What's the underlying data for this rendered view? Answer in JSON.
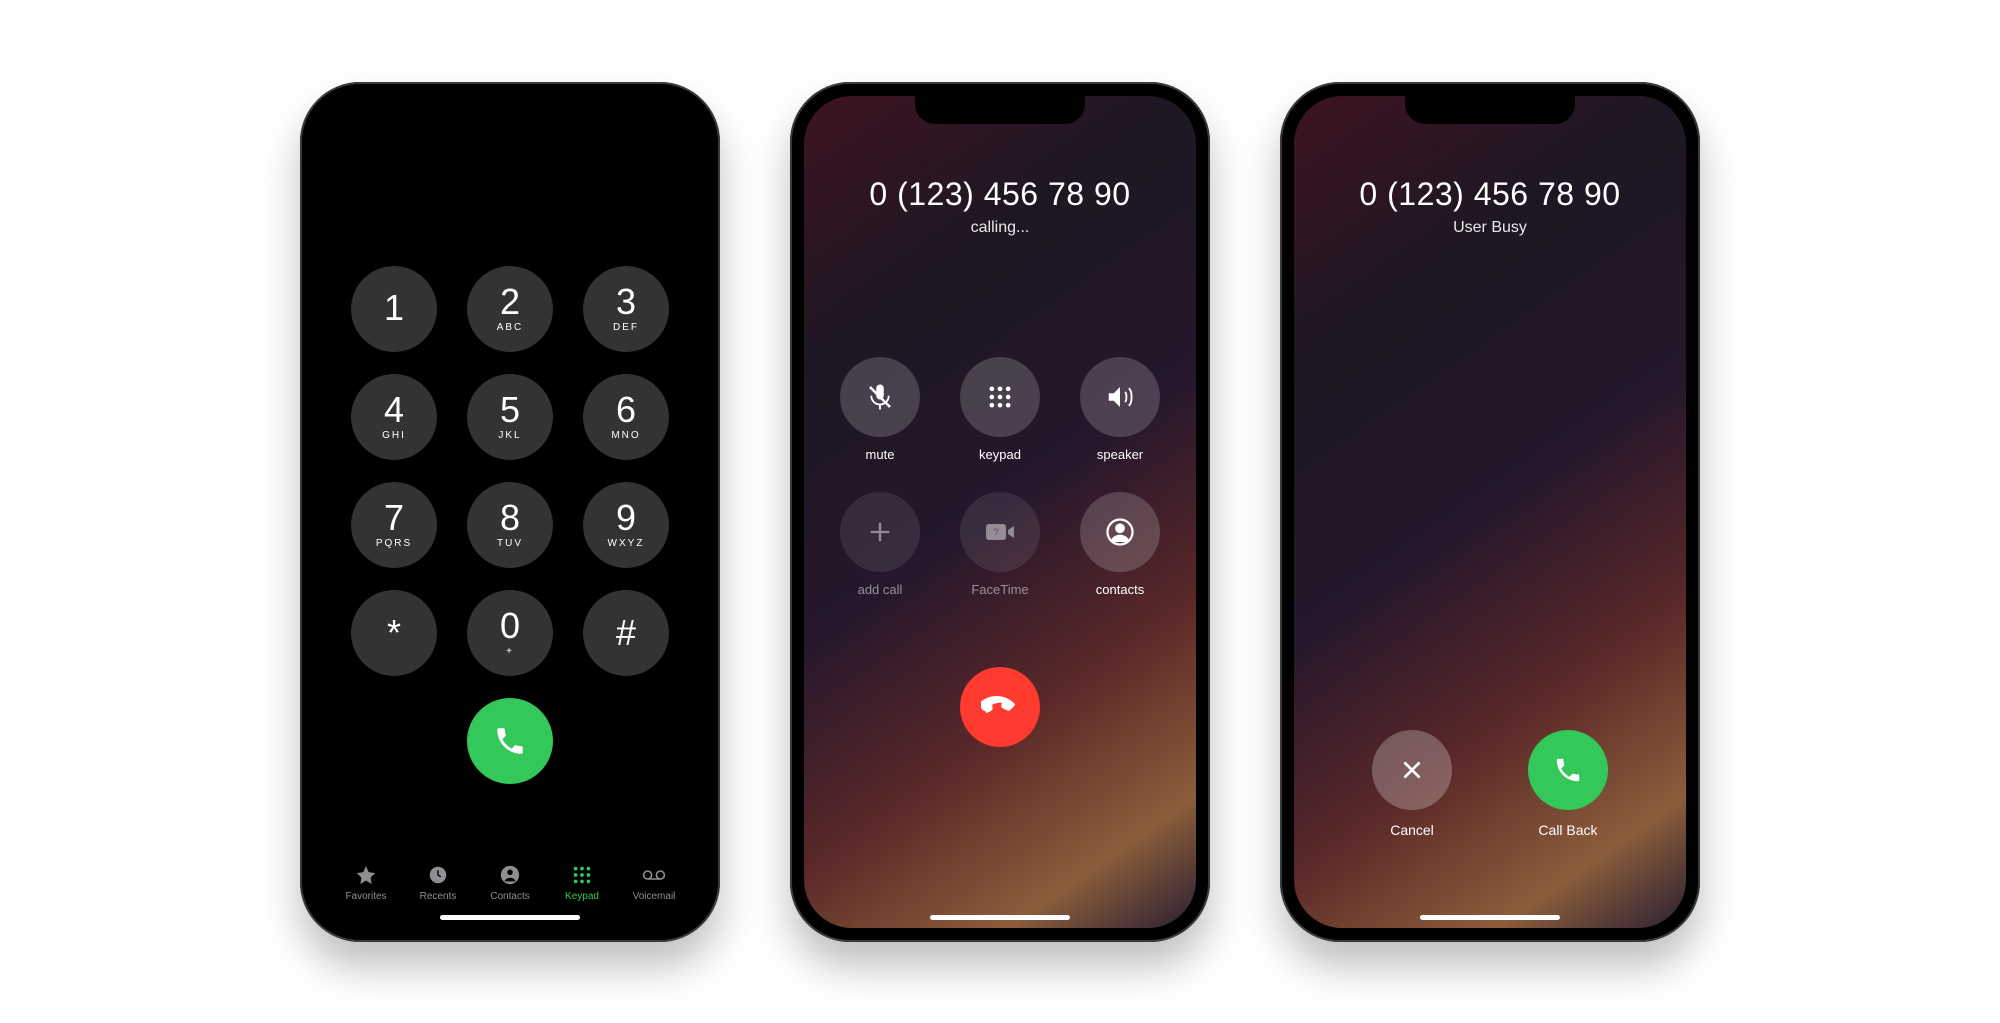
{
  "dialer": {
    "keys": [
      {
        "digit": "1",
        "letters": ""
      },
      {
        "digit": "2",
        "letters": "ABC"
      },
      {
        "digit": "3",
        "letters": "DEF"
      },
      {
        "digit": "4",
        "letters": "GHI"
      },
      {
        "digit": "5",
        "letters": "JKL"
      },
      {
        "digit": "6",
        "letters": "MNO"
      },
      {
        "digit": "7",
        "letters": "PQRS"
      },
      {
        "digit": "8",
        "letters": "TUV"
      },
      {
        "digit": "9",
        "letters": "WXYZ"
      },
      {
        "digit": "*",
        "letters": ""
      },
      {
        "digit": "0",
        "letters": "+"
      },
      {
        "digit": "#",
        "letters": ""
      }
    ],
    "tabs": [
      {
        "label": "Favorites"
      },
      {
        "label": "Recents"
      },
      {
        "label": "Contacts"
      },
      {
        "label": "Keypad"
      },
      {
        "label": "Voicemail"
      }
    ]
  },
  "calling": {
    "number": "0 (123) 456 78 90",
    "status": "calling...",
    "actions": {
      "mute": "mute",
      "keypad": "keypad",
      "speaker": "speaker",
      "add_call": "add call",
      "facetime": "FaceTime",
      "contacts": "contacts"
    }
  },
  "busy": {
    "number": "0 (123) 456 78 90",
    "status": "User Busy",
    "cancel": "Cancel",
    "callback": "Call Back"
  }
}
